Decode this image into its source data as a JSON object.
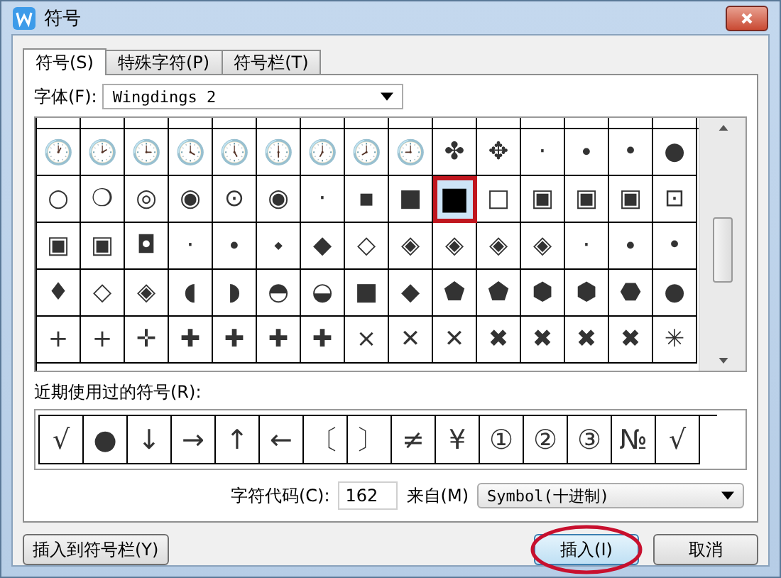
{
  "window": {
    "title": "符号"
  },
  "tabs": [
    {
      "label": "符号(S)",
      "selected": true
    },
    {
      "label": "特殊字符(P)",
      "selected": false
    },
    {
      "label": "符号栏(T)",
      "selected": false
    }
  ],
  "font": {
    "label": "字体(F):",
    "value": "Wingdings 2"
  },
  "symbol_grid": {
    "rows": [
      [
        {
          "char": "🕐",
          "selected": false
        },
        {
          "char": "🕑",
          "selected": false
        },
        {
          "char": "🕒",
          "selected": false
        },
        {
          "char": "🕓",
          "selected": false
        },
        {
          "char": "🕔",
          "selected": false
        },
        {
          "char": "🕕",
          "selected": false
        },
        {
          "char": "🕖",
          "selected": false
        },
        {
          "char": "🕗",
          "selected": false
        },
        {
          "char": "🕘",
          "selected": false
        },
        {
          "char": "✤",
          "selected": false
        },
        {
          "char": "✥",
          "selected": false
        },
        {
          "char": "·",
          "selected": false
        },
        {
          "char": "∙",
          "selected": false
        },
        {
          "char": "•",
          "selected": false
        },
        {
          "char": "●",
          "selected": false
        }
      ],
      [
        {
          "char": "○",
          "selected": false
        },
        {
          "char": "❍",
          "selected": false
        },
        {
          "char": "◎",
          "selected": false
        },
        {
          "char": "◉",
          "selected": false
        },
        {
          "char": "⊙",
          "selected": false
        },
        {
          "char": "◉",
          "selected": false
        },
        {
          "char": "·",
          "selected": false
        },
        {
          "char": "▪",
          "selected": false
        },
        {
          "char": "■",
          "selected": false
        },
        {
          "char": "■",
          "selected": true
        },
        {
          "char": "□",
          "selected": false
        },
        {
          "char": "▣",
          "selected": false
        },
        {
          "char": "▣",
          "selected": false
        },
        {
          "char": "▣",
          "selected": false
        },
        {
          "char": "⊡",
          "selected": false
        }
      ],
      [
        {
          "char": "▣",
          "selected": false
        },
        {
          "char": "▣",
          "selected": false
        },
        {
          "char": "◘",
          "selected": false
        },
        {
          "char": "·",
          "selected": false
        },
        {
          "char": "∙",
          "selected": false
        },
        {
          "char": "⬩",
          "selected": false
        },
        {
          "char": "◆",
          "selected": false
        },
        {
          "char": "◇",
          "selected": false
        },
        {
          "char": "◈",
          "selected": false
        },
        {
          "char": "◈",
          "selected": false
        },
        {
          "char": "◈",
          "selected": false
        },
        {
          "char": "◈",
          "selected": false
        },
        {
          "char": "·",
          "selected": false
        },
        {
          "char": "∙",
          "selected": false
        },
        {
          "char": "•",
          "selected": false
        }
      ],
      [
        {
          "char": "♦",
          "selected": false
        },
        {
          "char": "◇",
          "selected": false
        },
        {
          "char": "◈",
          "selected": false
        },
        {
          "char": "◖",
          "selected": false
        },
        {
          "char": "◗",
          "selected": false
        },
        {
          "char": "◓",
          "selected": false
        },
        {
          "char": "◒",
          "selected": false
        },
        {
          "char": "■",
          "selected": false
        },
        {
          "char": "◆",
          "selected": false
        },
        {
          "char": "⬟",
          "selected": false
        },
        {
          "char": "⬟",
          "selected": false
        },
        {
          "char": "⬢",
          "selected": false
        },
        {
          "char": "⬢",
          "selected": false
        },
        {
          "char": "⬣",
          "selected": false
        },
        {
          "char": "●",
          "selected": false
        }
      ],
      [
        {
          "char": "+",
          "selected": false
        },
        {
          "char": "+",
          "selected": false
        },
        {
          "char": "✛",
          "selected": false
        },
        {
          "char": "✚",
          "selected": false
        },
        {
          "char": "✚",
          "selected": false
        },
        {
          "char": "✚",
          "selected": false
        },
        {
          "char": "✚",
          "selected": false
        },
        {
          "char": "×",
          "selected": false
        },
        {
          "char": "✕",
          "selected": false
        },
        {
          "char": "✕",
          "selected": false
        },
        {
          "char": "✖",
          "selected": false
        },
        {
          "char": "✖",
          "selected": false
        },
        {
          "char": "✖",
          "selected": false
        },
        {
          "char": "✖",
          "selected": false
        },
        {
          "char": "✳",
          "selected": false
        }
      ]
    ]
  },
  "recent": {
    "label": "近期使用过的符号(R):",
    "symbols": [
      "√",
      "●",
      "↓",
      "→",
      "↑",
      "←",
      "〔",
      "〕",
      "≠",
      "¥",
      "①",
      "②",
      "③",
      "№",
      "√"
    ]
  },
  "code": {
    "label": "字符代码(C):",
    "value": "162",
    "from_label": "来自(M)",
    "from_value": "Symbol(十进制)"
  },
  "buttons": [
    {
      "label": "插入到符号栏(Y)",
      "default": false
    },
    {
      "label": "插入(I)",
      "default": true
    },
    {
      "label": "取消",
      "default": false
    }
  ]
}
